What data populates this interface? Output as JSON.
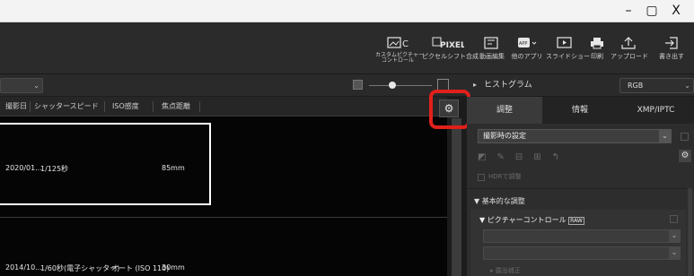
{
  "window": {
    "minimize": "–",
    "restore": "▢",
    "close": "X"
  },
  "toolbar": {
    "items": [
      {
        "name": "picture-control",
        "label": "カスタムピクチャー\nコントロール"
      },
      {
        "name": "pixel-shift",
        "icon_text": "PIXEL",
        "label": "ピクセルシフト合成"
      },
      {
        "name": "movie-edit",
        "label": "動画編集"
      },
      {
        "name": "other-apps",
        "icon_text": "APP",
        "label": "他のアプリ"
      },
      {
        "name": "slideshow",
        "label": "スライドショー"
      },
      {
        "name": "print",
        "label": "印刷"
      },
      {
        "name": "upload",
        "label": "アップロード"
      },
      {
        "name": "export",
        "label": "書き出す"
      }
    ]
  },
  "histogram": {
    "label": "ヒストグラム",
    "channel": "RGB"
  },
  "columns": [
    "撮影日",
    "シャッタースピード",
    "ISO感度",
    "焦点距離"
  ],
  "rows": [
    {
      "date": "2020/01...",
      "shutter": "1/125秒",
      "iso": "",
      "focal": "85mm",
      "selected": true
    },
    {
      "date": "2014/10...",
      "shutter": "1/60秒(電子シャッター)",
      "iso": "オート (ISO 110)",
      "focal": "30mm",
      "selected": false
    }
  ],
  "panel": {
    "tabs": [
      "調整",
      "情報",
      "XMP/IPTC"
    ],
    "preset": "撮影時の設定",
    "hdr": "HDRで調整",
    "basic": "基本的な調整",
    "picture_control": "ピクチャーコントロール",
    "raw_badge": "RAW",
    "bottom_item": "露出補正"
  },
  "colors": {
    "highlight": "#e0201b",
    "accent": "#ffffff"
  }
}
